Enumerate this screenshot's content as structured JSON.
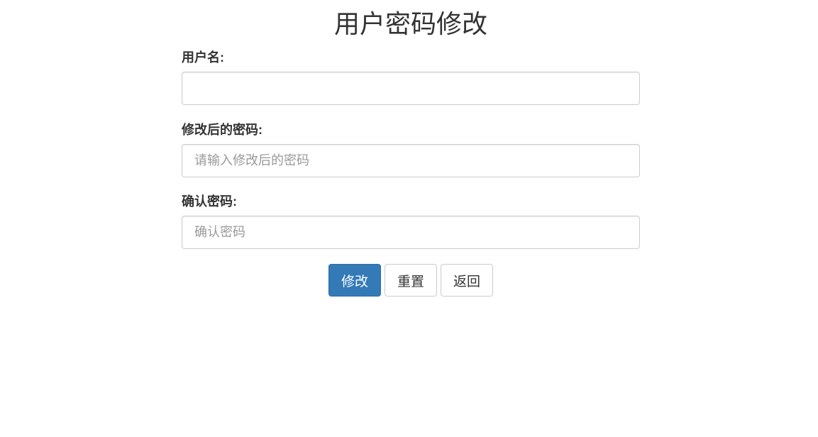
{
  "page": {
    "title": "用户密码修改"
  },
  "form": {
    "username": {
      "label": "用户名:",
      "value": "",
      "placeholder": ""
    },
    "new_password": {
      "label": "修改后的密码:",
      "value": "",
      "placeholder": "请输入修改后的密码"
    },
    "confirm_password": {
      "label": "确认密码:",
      "value": "",
      "placeholder": "确认密码"
    }
  },
  "buttons": {
    "submit_label": "修改",
    "reset_label": "重置",
    "back_label": "返回"
  },
  "colors": {
    "primary": "#337ab7",
    "text": "#333333",
    "border": "#cccccc",
    "placeholder": "#999999"
  }
}
